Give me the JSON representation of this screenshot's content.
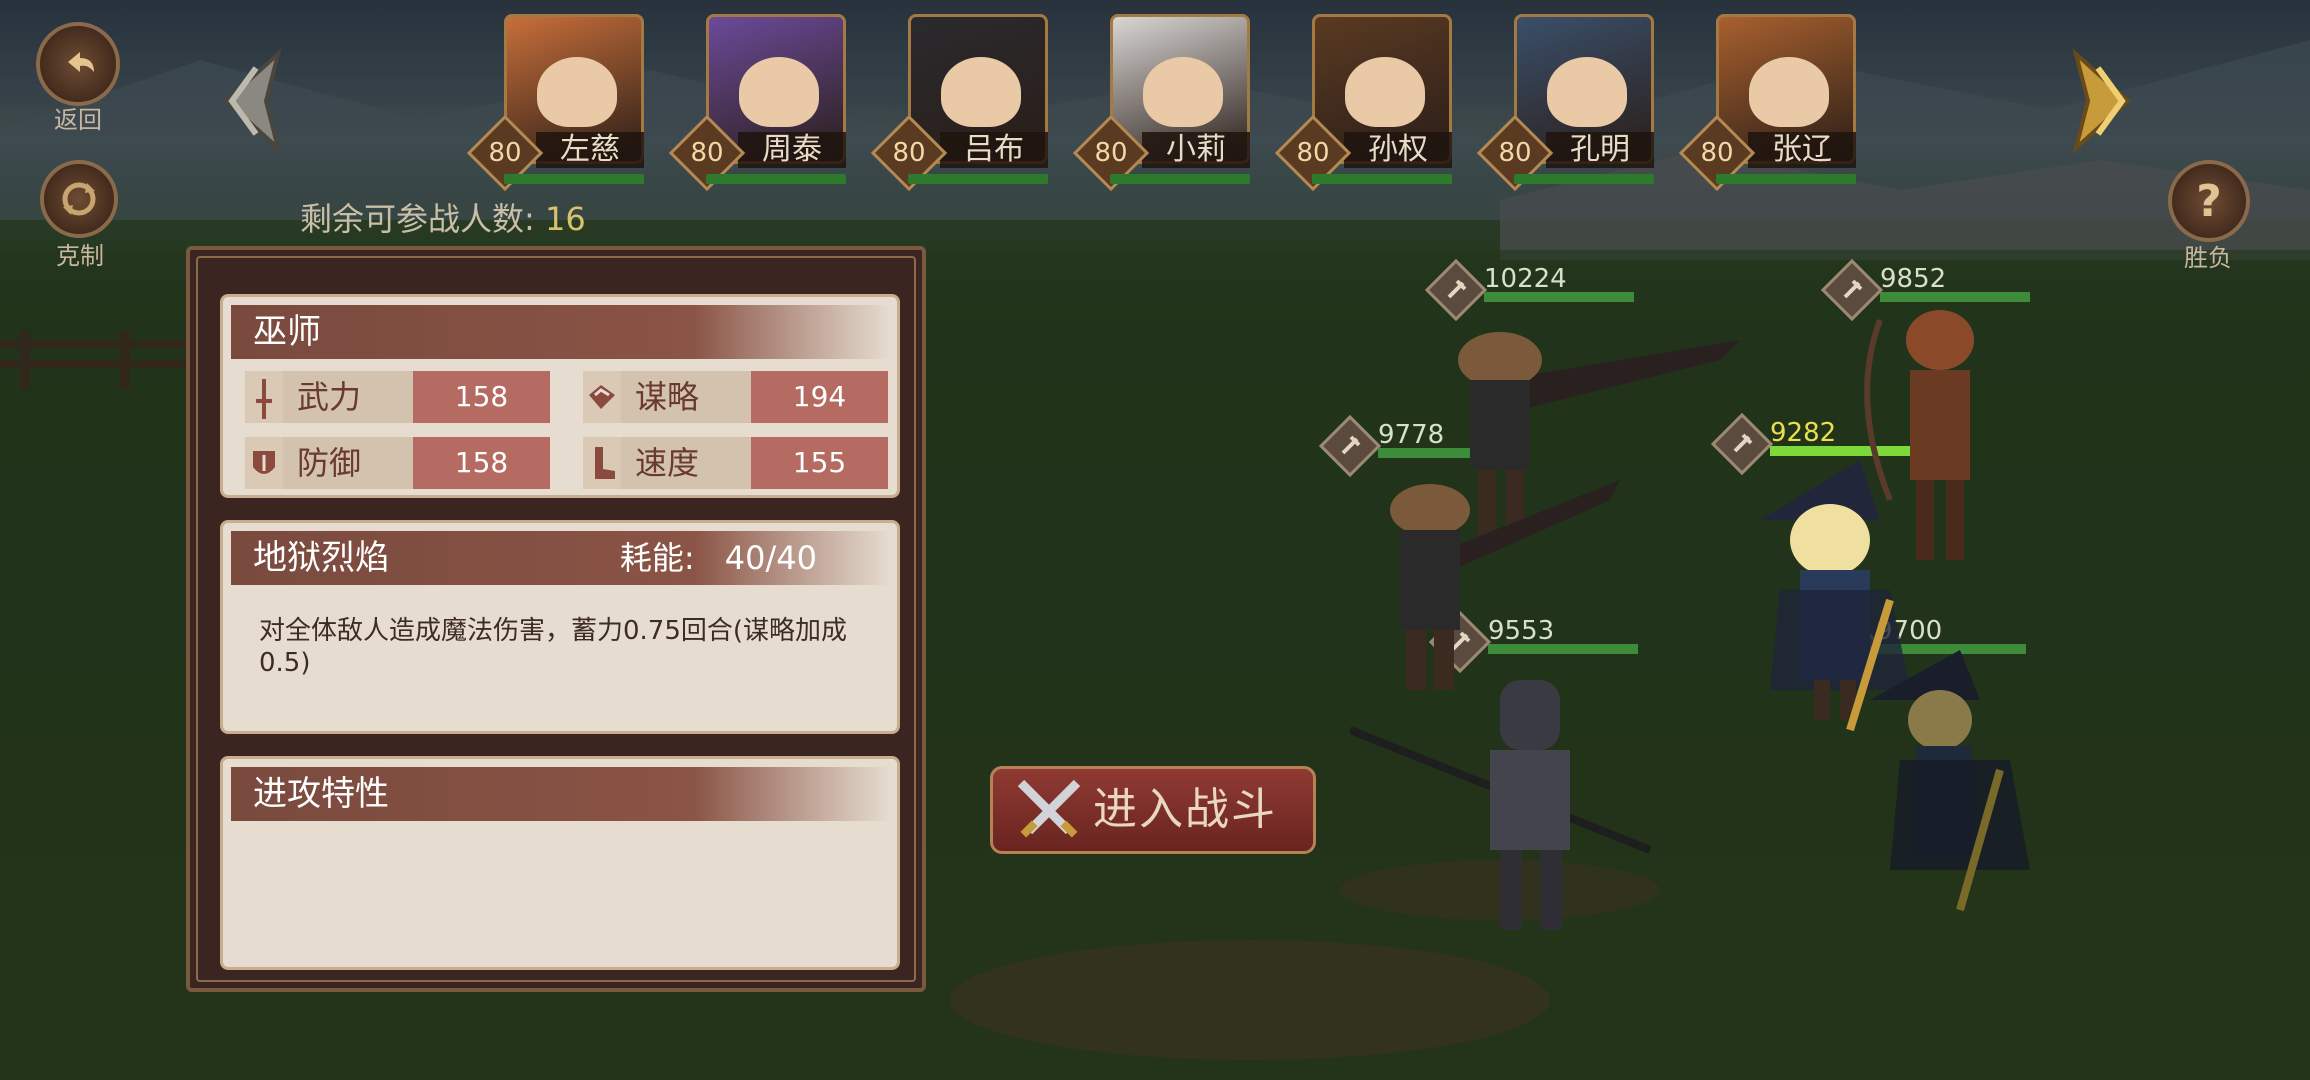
{
  "top_left": {
    "back_label": "返回",
    "counter_label": "克制"
  },
  "top_right": {
    "help_label": "胜负"
  },
  "heroes": [
    {
      "level": "80",
      "name": "左慈",
      "color": "#c76e3a"
    },
    {
      "level": "80",
      "name": "周泰",
      "color": "#6b4a9a"
    },
    {
      "level": "80",
      "name": "吕布",
      "color": "#2a2a2e"
    },
    {
      "level": "80",
      "name": "小莉",
      "color": "#d8d6d4"
    },
    {
      "level": "80",
      "name": "孙权",
      "color": "#5a3a22"
    },
    {
      "level": "80",
      "name": "孔明",
      "color": "#3a4f6a"
    },
    {
      "level": "80",
      "name": "张辽",
      "color": "#a8602e"
    }
  ],
  "remaining": {
    "label": "剩余可参战人数:",
    "value": "16"
  },
  "info_panel": {
    "class_name": "巫师",
    "stats": [
      {
        "label": "武力",
        "value": "158",
        "icon": "sword-icon"
      },
      {
        "label": "谋略",
        "value": "194",
        "icon": "scroll-icon"
      },
      {
        "label": "防御",
        "value": "158",
        "icon": "shield-icon"
      },
      {
        "label": "速度",
        "value": "155",
        "icon": "boot-icon"
      }
    ],
    "skill": {
      "name": "地狱烈焰",
      "cost_label": "耗能:",
      "cost_value": "40/40",
      "description": "对全体敌人造成魔法伤害，蓄力0.75回合(谋略加成0.5)"
    },
    "traits": {
      "title": "进攻特性"
    }
  },
  "battle_button": {
    "label": "进入战斗"
  },
  "units": [
    {
      "hp": "10224",
      "icon": "axe-icon"
    },
    {
      "hp": "9852",
      "icon": "bow-icon"
    },
    {
      "hp": "9778",
      "icon": "axe-icon"
    },
    {
      "hp": "9282",
      "icon": "staff-icon"
    },
    {
      "hp": "9553",
      "icon": "spear-icon"
    },
    {
      "hp": "9700",
      "icon": "staff-icon"
    }
  ]
}
